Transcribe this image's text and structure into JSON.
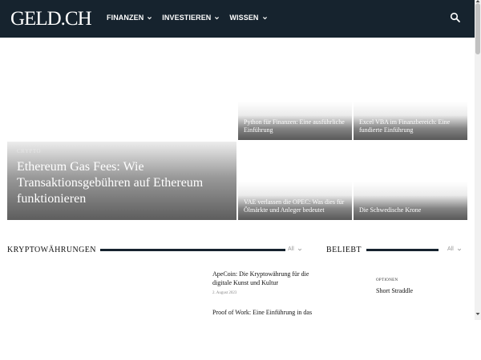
{
  "header": {
    "logo": "GELD.CH",
    "nav": [
      {
        "label": "Finanzen"
      },
      {
        "label": "Investieren"
      },
      {
        "label": "Wissen"
      }
    ],
    "search_icon": "search-icon",
    "background": "#16232e"
  },
  "featured": {
    "big": {
      "category": "Crypto",
      "title": "Ethereum Gas Fees: Wie Transaktionsgebühren auf Ethereum funktionieren"
    },
    "small": [
      {
        "title": "Python für Finanzen: Eine ausführliche Einführung"
      },
      {
        "title": "Excel VBA im Finanzbereich: Eine fundierte Einführung"
      },
      {
        "title": "VAE verlassen die OPEC: Was dies für Ölmärkte und Anleger bedeutet"
      },
      {
        "title": "Die Schwedische Krone"
      }
    ]
  },
  "crypto_section": {
    "title": "Kryptowährungen",
    "all_label": "All",
    "articles": [
      {
        "title": "ApeCoin: Die Kryptowährung für die digitale Kunst und Kultur",
        "date": "2. August 2023"
      },
      {
        "title": "Proof of Work: Eine Einführung in das Herzstück der"
      }
    ]
  },
  "popular_section": {
    "title": "Beliebt",
    "all_label": "All",
    "items": [
      {
        "category": "Optionen",
        "title": "Short Straddle"
      }
    ]
  }
}
